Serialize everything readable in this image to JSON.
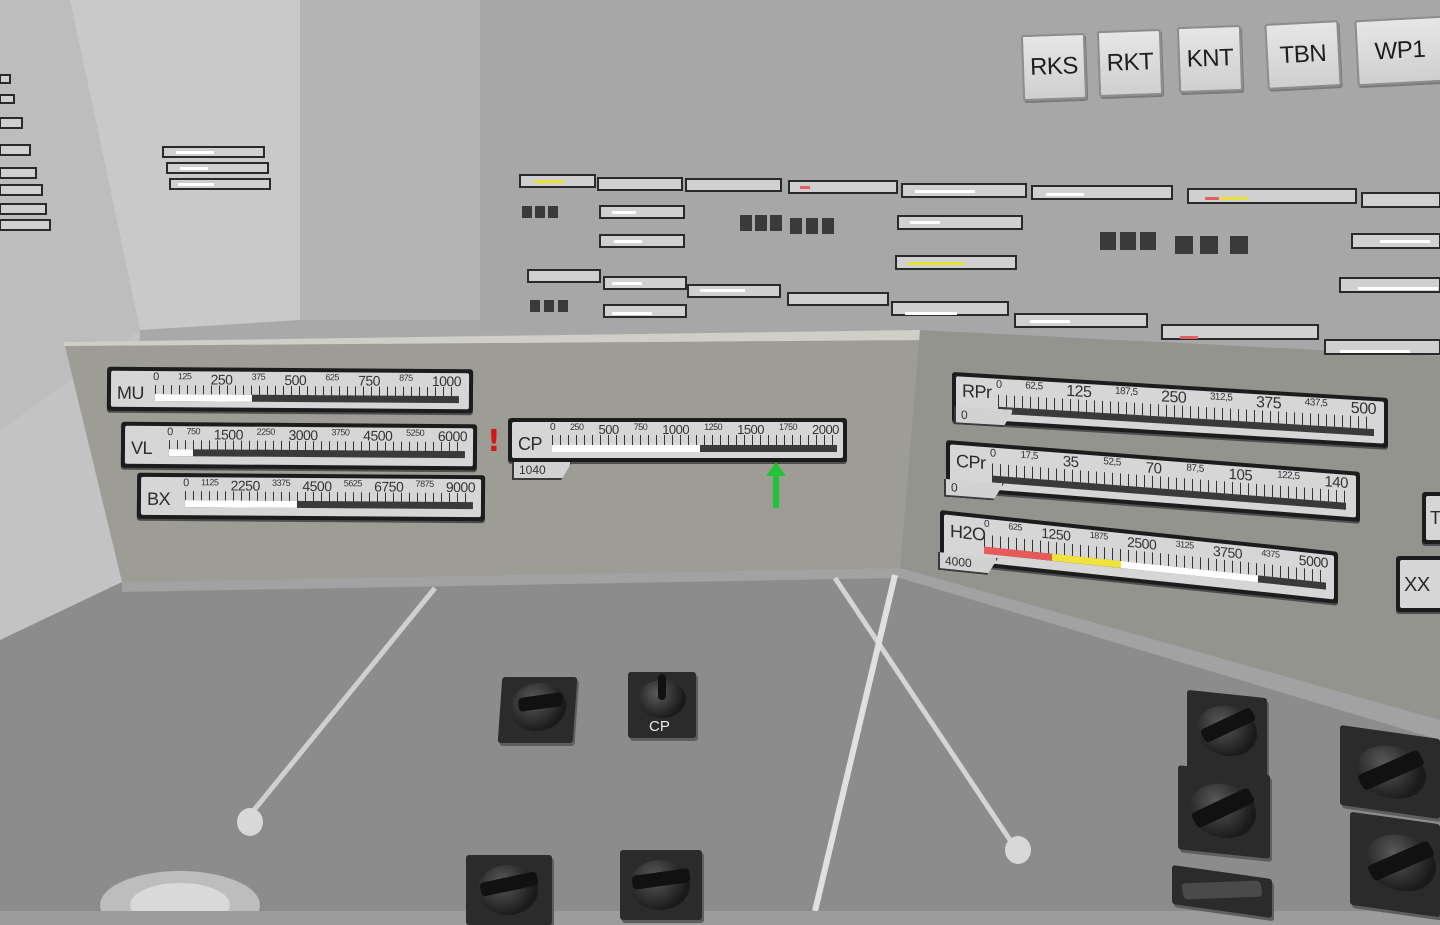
{
  "annunciators": [
    {
      "label": "RKS"
    },
    {
      "label": "RKT"
    },
    {
      "label": "KNT"
    },
    {
      "label": "TBN"
    },
    {
      "label": "WP1"
    }
  ],
  "left_panel": {
    "meters": [
      {
        "name": "MU",
        "ticks": [
          "0",
          "125",
          "250",
          "375",
          "500",
          "625",
          "750",
          "875",
          "1000"
        ],
        "level": 0.32
      },
      {
        "name": "VL",
        "ticks": [
          "0",
          "750",
          "1500",
          "2250",
          "3000",
          "3750",
          "4500",
          "5250",
          "6000"
        ],
        "level": 0.08
      },
      {
        "name": "BX",
        "ticks": [
          "0",
          "1125",
          "2250",
          "3375",
          "4500",
          "5625",
          "6750",
          "7875",
          "9000"
        ],
        "level": 0.39
      }
    ],
    "warning_symbol": "!",
    "cp_meter": {
      "name": "CP",
      "ticks": [
        "0",
        "250",
        "500",
        "750",
        "1000",
        "1250",
        "1500",
        "1750",
        "2000"
      ],
      "level": 0.52,
      "readout": "1040"
    },
    "indicator_arrow": "green-up-arrow",
    "indicator_color": "#22c23a"
  },
  "right_panel": {
    "meters": [
      {
        "name": "RPr",
        "ticks": [
          "0",
          "62,5",
          "125",
          "187,5",
          "250",
          "312,5",
          "375",
          "437,5",
          "500"
        ],
        "level": 0.0,
        "readout": "0"
      },
      {
        "name": "CPr",
        "ticks": [
          "0",
          "17,5",
          "35",
          "52,5",
          "70",
          "87,5",
          "105",
          "122,5",
          "140"
        ],
        "level": 0.0,
        "readout": "0"
      },
      {
        "name": "H2O",
        "ticks": [
          "0",
          "625",
          "1250",
          "1875",
          "2500",
          "3125",
          "3750",
          "4375",
          "5000"
        ],
        "level": 0.8,
        "readout": "4000",
        "zones": [
          {
            "color": "#e85a5a",
            "to": 0.2
          },
          {
            "color": "#f0e33c",
            "to": 0.4
          },
          {
            "color": "#ffffff",
            "to": 0.8
          }
        ]
      }
    ],
    "edge_labels": [
      "T",
      "XX"
    ]
  },
  "console": {
    "knob_label": "CP"
  },
  "colors": {
    "needle_bar": "#ffffff",
    "warning": "#d01818"
  }
}
